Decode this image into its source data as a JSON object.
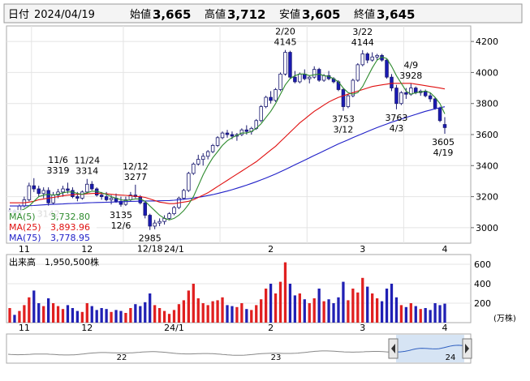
{
  "header": {
    "date_label": "日付",
    "date": "2024/04/19",
    "open_label": "始値",
    "open": "3,665",
    "high_label": "高値",
    "high": "3,712",
    "low_label": "安値",
    "low": "3,605",
    "close_label": "終値",
    "close": "3,645"
  },
  "colors": {
    "up": "#ffffff",
    "down": "#1a1ab4",
    "ma5": "#2e8b2e",
    "ma25": "#e01010",
    "ma75": "#2020c8",
    "vol_up": "#e02020",
    "vol_down": "#2020b4",
    "high_value": "#e00000",
    "low_value": "#008000"
  },
  "legend": [
    {
      "label": "MA(5)",
      "value": "3,732.80"
    },
    {
      "label": "MA(25)",
      "value": "3,893.96"
    },
    {
      "label": "MA(75)",
      "value": "3,778.95"
    }
  ],
  "price_axis": {
    "ticks": [
      "4200",
      "4000",
      "3800",
      "3600",
      "3400",
      "3200",
      "3000"
    ]
  },
  "month_labels": [
    "11",
    "12",
    "24/1",
    "2",
    "3",
    "4"
  ],
  "volume_panel": {
    "title": "出来高　1,950,500株",
    "ticks": [
      "600",
      "400",
      "200"
    ],
    "unit": "(万株)"
  },
  "navigator": {
    "labels": [
      "22",
      "23",
      "24"
    ]
  },
  "chart_data": {
    "type": "candlestick",
    "period": "2023/10/25 - 2024/04/19",
    "ylim": [
      2900,
      4300
    ],
    "annotations": [
      {
        "date": "11/6",
        "price": "3319",
        "kind": "high"
      },
      {
        "date": "11/24",
        "price": "3314",
        "kind": "high"
      },
      {
        "date": "12/12",
        "price": "3277",
        "kind": "high"
      },
      {
        "date": "2/20",
        "price": "4145",
        "kind": "high"
      },
      {
        "date": "3/22",
        "price": "4144",
        "kind": "high"
      },
      {
        "date": "4/9",
        "price": "3928",
        "kind": "high"
      },
      {
        "date": "",
        "price": "3142",
        "kind": "low"
      },
      {
        "date": "12/6",
        "price": "3135",
        "kind": "low"
      },
      {
        "date": "12/18",
        "price": "2985",
        "kind": "low"
      },
      {
        "date": "3/12",
        "price": "3753",
        "kind": "low"
      },
      {
        "date": "4/3",
        "price": "3763",
        "kind": "low"
      },
      {
        "date": "4/19",
        "price": "3605",
        "kind": "low"
      }
    ],
    "ohlc": [
      [
        3105,
        3125,
        3095,
        3110
      ],
      [
        3110,
        3115,
        3085,
        3095
      ],
      [
        3095,
        3150,
        3090,
        3140
      ],
      [
        3140,
        3200,
        3130,
        3180
      ],
      [
        3180,
        3290,
        3170,
        3270
      ],
      [
        3270,
        3319,
        3230,
        3250
      ],
      [
        3250,
        3270,
        3200,
        3220
      ],
      [
        3220,
        3260,
        3190,
        3240
      ],
      [
        3240,
        3260,
        3142,
        3160
      ],
      [
        3160,
        3230,
        3150,
        3210
      ],
      [
        3210,
        3250,
        3190,
        3230
      ],
      [
        3230,
        3270,
        3200,
        3250
      ],
      [
        3250,
        3290,
        3220,
        3240
      ],
      [
        3240,
        3260,
        3190,
        3200
      ],
      [
        3200,
        3230,
        3170,
        3190
      ],
      [
        3190,
        3240,
        3180,
        3230
      ],
      [
        3230,
        3314,
        3220,
        3280
      ],
      [
        3280,
        3300,
        3240,
        3250
      ],
      [
        3250,
        3260,
        3200,
        3210
      ],
      [
        3210,
        3230,
        3180,
        3200
      ],
      [
        3200,
        3230,
        3170,
        3180
      ],
      [
        3180,
        3210,
        3150,
        3190
      ],
      [
        3190,
        3220,
        3160,
        3170
      ],
      [
        3170,
        3200,
        3135,
        3150
      ],
      [
        3150,
        3200,
        3140,
        3180
      ],
      [
        3180,
        3230,
        3170,
        3210
      ],
      [
        3210,
        3277,
        3190,
        3200
      ],
      [
        3200,
        3210,
        3150,
        3160
      ],
      [
        3160,
        3170,
        3060,
        3080
      ],
      [
        3080,
        3090,
        2985,
        3010
      ],
      [
        3010,
        3050,
        2990,
        3030
      ],
      [
        3030,
        3060,
        3010,
        3040
      ],
      [
        3040,
        3080,
        3020,
        3060
      ],
      [
        3060,
        3100,
        3050,
        3090
      ],
      [
        3090,
        3140,
        3080,
        3130
      ],
      [
        3130,
        3200,
        3120,
        3190
      ],
      [
        3190,
        3250,
        3180,
        3240
      ],
      [
        3240,
        3360,
        3230,
        3350
      ],
      [
        3350,
        3420,
        3340,
        3410
      ],
      [
        3410,
        3470,
        3400,
        3440
      ],
      [
        3440,
        3480,
        3400,
        3460
      ],
      [
        3460,
        3500,
        3440,
        3490
      ],
      [
        3490,
        3540,
        3480,
        3530
      ],
      [
        3530,
        3590,
        3520,
        3580
      ],
      [
        3580,
        3620,
        3570,
        3610
      ],
      [
        3610,
        3630,
        3580,
        3600
      ],
      [
        3600,
        3620,
        3570,
        3590
      ],
      [
        3590,
        3610,
        3560,
        3600
      ],
      [
        3600,
        3640,
        3590,
        3630
      ],
      [
        3630,
        3660,
        3600,
        3620
      ],
      [
        3620,
        3650,
        3600,
        3640
      ],
      [
        3640,
        3700,
        3630,
        3690
      ],
      [
        3690,
        3790,
        3680,
        3780
      ],
      [
        3780,
        3850,
        3770,
        3840
      ],
      [
        3840,
        3880,
        3800,
        3820
      ],
      [
        3820,
        3900,
        3810,
        3890
      ],
      [
        3890,
        4000,
        3880,
        3990
      ],
      [
        3990,
        4145,
        3980,
        4130
      ],
      [
        4130,
        4140,
        3960,
        3970
      ],
      [
        3970,
        4010,
        3930,
        3940
      ],
      [
        3940,
        4000,
        3930,
        3990
      ],
      [
        3990,
        4020,
        3950,
        3960
      ],
      [
        3960,
        3980,
        3930,
        3970
      ],
      [
        3970,
        4040,
        3960,
        4020
      ],
      [
        4020,
        4030,
        3940,
        3950
      ],
      [
        3950,
        3990,
        3940,
        3980
      ],
      [
        3980,
        4010,
        3950,
        3960
      ],
      [
        3960,
        3970,
        3930,
        3940
      ],
      [
        3940,
        3950,
        3880,
        3890
      ],
      [
        3890,
        3900,
        3753,
        3780
      ],
      [
        3780,
        3860,
        3770,
        3850
      ],
      [
        3850,
        3960,
        3840,
        3950
      ],
      [
        3950,
        4060,
        3940,
        4050
      ],
      [
        4050,
        4144,
        4040,
        4120
      ],
      [
        4120,
        4130,
        4060,
        4080
      ],
      [
        4080,
        4130,
        4070,
        4100
      ],
      [
        4100,
        4120,
        4080,
        4110
      ],
      [
        4110,
        4120,
        4070,
        4080
      ],
      [
        4080,
        4090,
        3960,
        3970
      ],
      [
        3970,
        3990,
        3880,
        3900
      ],
      [
        3900,
        3920,
        3763,
        3800
      ],
      [
        3800,
        3880,
        3790,
        3870
      ],
      [
        3870,
        3900,
        3830,
        3860
      ],
      [
        3860,
        3928,
        3850,
        3900
      ],
      [
        3900,
        3910,
        3860,
        3870
      ],
      [
        3870,
        3890,
        3850,
        3880
      ],
      [
        3880,
        3890,
        3840,
        3850
      ],
      [
        3850,
        3870,
        3810,
        3830
      ],
      [
        3830,
        3840,
        3760,
        3770
      ],
      [
        3770,
        3780,
        3680,
        3690
      ],
      [
        3665,
        3712,
        3605,
        3645
      ]
    ],
    "ma5": [
      3090,
      3095,
      3105,
      3120,
      3140,
      3170,
      3200,
      3210,
      3215,
      3210,
      3215,
      3225,
      3230,
      3230,
      3220,
      3215,
      3225,
      3235,
      3235,
      3225,
      3215,
      3200,
      3190,
      3180,
      3175,
      3180,
      3185,
      3185,
      3170,
      3140,
      3110,
      3080,
      3060,
      3050,
      3060,
      3080,
      3110,
      3150,
      3200,
      3270,
      3340,
      3400,
      3450,
      3490,
      3530,
      3560,
      3580,
      3595,
      3610,
      3610,
      3620,
      3640,
      3670,
      3710,
      3750,
      3800,
      3860,
      3920,
      3960,
      3980,
      3990,
      3990,
      3980,
      3985,
      3990,
      3980,
      3975,
      3960,
      3940,
      3900,
      3870,
      3860,
      3870,
      3910,
      3970,
      4030,
      4080,
      4100,
      4090,
      4040,
      3980,
      3930,
      3880,
      3860,
      3870,
      3875,
      3880,
      3870,
      3840,
      3800,
      3733
    ],
    "ma25": [
      3160,
      3160,
      3160,
      3160,
      3165,
      3170,
      3180,
      3185,
      3190,
      3195,
      3200,
      3205,
      3210,
      3212,
      3215,
      3215,
      3218,
      3220,
      3222,
      3220,
      3218,
      3215,
      3212,
      3210,
      3208,
      3205,
      3202,
      3200,
      3195,
      3185,
      3175,
      3165,
      3160,
      3155,
      3155,
      3160,
      3165,
      3170,
      3180,
      3195,
      3210,
      3225,
      3245,
      3265,
      3285,
      3305,
      3325,
      3345,
      3365,
      3385,
      3405,
      3425,
      3450,
      3475,
      3500,
      3525,
      3555,
      3585,
      3615,
      3645,
      3675,
      3700,
      3725,
      3750,
      3770,
      3790,
      3810,
      3825,
      3840,
      3850,
      3860,
      3870,
      3880,
      3890,
      3900,
      3910,
      3915,
      3920,
      3925,
      3930,
      3930,
      3930,
      3930,
      3930,
      3925,
      3920,
      3915,
      3910,
      3905,
      3900,
      3894
    ],
    "ma75": [
      3140,
      3140,
      3140,
      3141,
      3142,
      3143,
      3145,
      3147,
      3149,
      3150,
      3152,
      3153,
      3155,
      3156,
      3157,
      3158,
      3160,
      3161,
      3162,
      3163,
      3164,
      3165,
      3166,
      3167,
      3168,
      3169,
      3170,
      3171,
      3172,
      3172,
      3172,
      3173,
      3174,
      3175,
      3177,
      3180,
      3183,
      3187,
      3191,
      3196,
      3201,
      3207,
      3213,
      3220,
      3228,
      3236,
      3245,
      3254,
      3264,
      3274,
      3285,
      3296,
      3308,
      3320,
      3333,
      3346,
      3360,
      3375,
      3390,
      3405,
      3420,
      3435,
      3450,
      3465,
      3480,
      3495,
      3510,
      3525,
      3540,
      3553,
      3566,
      3580,
      3593,
      3607,
      3620,
      3633,
      3645,
      3657,
      3668,
      3680,
      3690,
      3700,
      3710,
      3720,
      3730,
      3740,
      3750,
      3758,
      3766,
      3773,
      3779
    ],
    "volume": [
      150,
      80,
      120,
      180,
      260,
      330,
      200,
      170,
      250,
      200,
      170,
      140,
      180,
      150,
      120,
      110,
      200,
      170,
      130,
      150,
      140,
      110,
      130,
      120,
      100,
      150,
      190,
      170,
      210,
      300,
      180,
      150,
      120,
      90,
      130,
      190,
      230,
      330,
      400,
      250,
      200,
      180,
      220,
      230,
      260,
      180,
      170,
      160,
      200,
      140,
      130,
      180,
      240,
      350,
      400,
      300,
      420,
      620,
      400,
      280,
      300,
      240,
      200,
      250,
      350,
      220,
      240,
      200,
      260,
      420,
      230,
      350,
      310,
      460,
      370,
      300,
      250,
      220,
      350,
      400,
      260,
      180,
      160,
      200,
      170,
      140,
      150,
      130,
      200,
      180,
      195
    ]
  }
}
